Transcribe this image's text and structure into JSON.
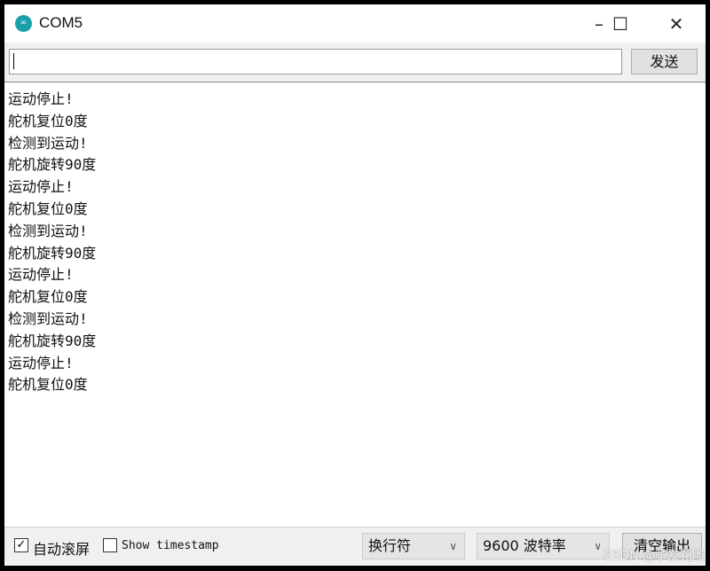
{
  "window": {
    "title": "COM5",
    "minimize": "–",
    "maximize": "☐",
    "close": "✕",
    "logo": "∞"
  },
  "input": {
    "value": "",
    "send_label": "发送"
  },
  "output": {
    "lines": [
      "运动停止!",
      "舵机复位0度",
      "检测到运动!",
      "舵机旋转90度",
      "运动停止!",
      "舵机复位0度",
      "检测到运动!",
      "舵机旋转90度",
      "运动停止!",
      "舵机复位0度",
      "检测到运动!",
      "舵机旋转90度",
      "运动停止!",
      "舵机复位0度"
    ]
  },
  "bottom": {
    "autoscroll_label": "自动滚屏",
    "autoscroll_checked": true,
    "timestamp_label": "Show timestamp",
    "timestamp_checked": false,
    "line_ending": "换行符",
    "baud": "9600 波特率",
    "clear_label": "清空输出"
  },
  "watermark": "CSDN @驴友花雕"
}
